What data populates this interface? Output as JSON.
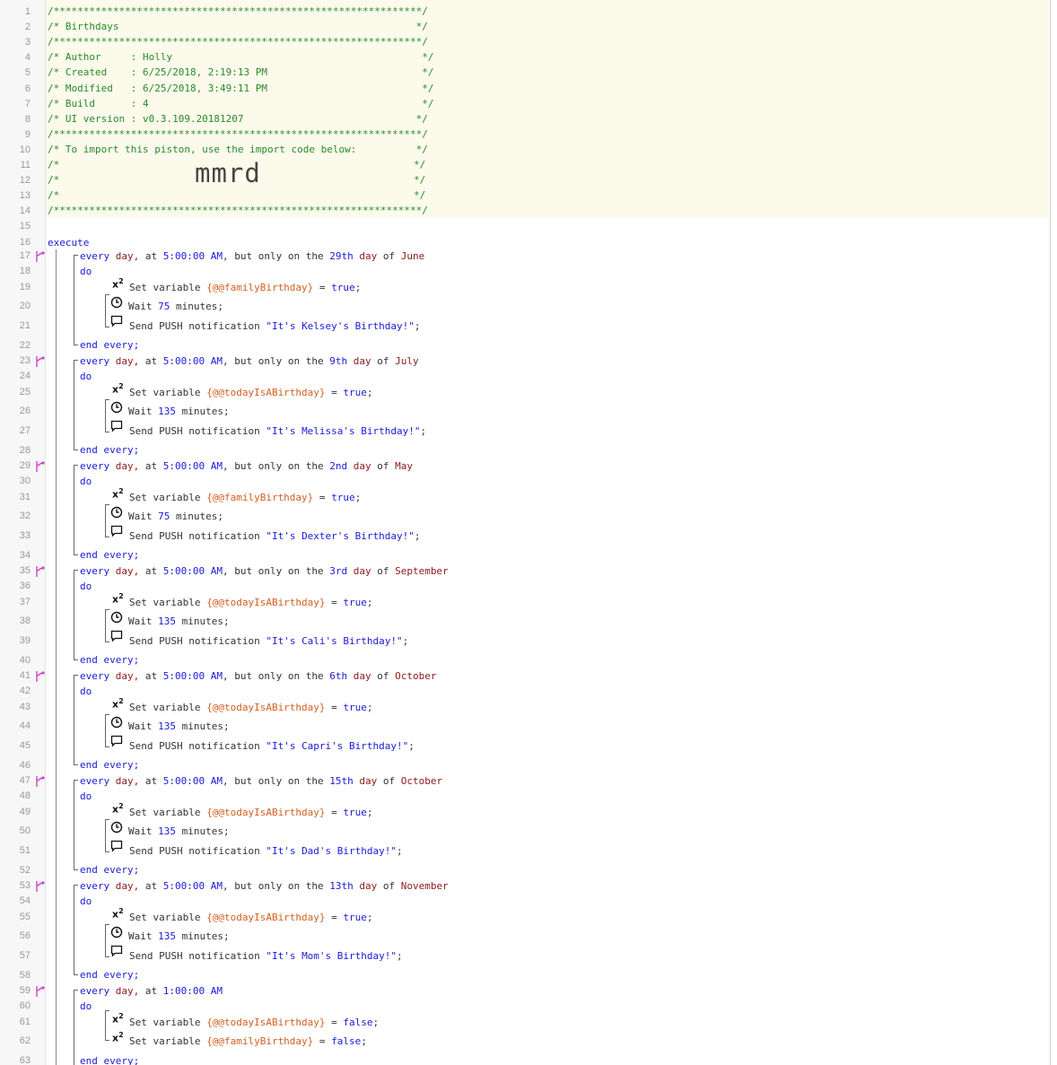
{
  "editor": {
    "header": {
      "line1": "/**************************************************************/",
      "title": "/* Birthdays                                                  */",
      "line3": "/**************************************************************/",
      "author": "/* Author     : Holly                                          */",
      "created": "/* Created    : 6/25/2018, 2:19:13 PM                          */",
      "modified": "/* Modified   : 6/25/2018, 3:49:11 PM                          */",
      "build": "/* Build      : 4                                              */",
      "ui_version": "/* UI version : v0.3.109.20181207                             */",
      "line9": "/**************************************************************/",
      "import_text": "/* To import this piston, use the import code below:          */",
      "blank_left": "/*",
      "blank_right": "*/",
      "import_code": "mmrd",
      "line14": "/**************************************************************/"
    },
    "execute": "execute",
    "blocks": [
      {
        "start": 17,
        "time": "5:00:00 AM",
        "daynum": "29th",
        "month": "June",
        "var": "{@@familyBirthday}",
        "wait": "75",
        "msg": "\"It's Kelsey's Birthday!\""
      },
      {
        "start": 23,
        "time": "5:00:00 AM",
        "daynum": "9th",
        "month": "July",
        "var": "{@@todayIsABirthday}",
        "wait": "135",
        "msg": "\"It's Melissa's Birthday!\""
      },
      {
        "start": 29,
        "time": "5:00:00 AM",
        "daynum": "2nd",
        "month": "May",
        "var": "{@@familyBirthday}",
        "wait": "75",
        "msg": "\"It's Dexter's Birthday!\""
      },
      {
        "start": 35,
        "time": "5:00:00 AM",
        "daynum": "3rd",
        "month": "September",
        "var": "{@@todayIsABirthday}",
        "wait": "135",
        "msg": "\"It's Cali's Birthday!\""
      },
      {
        "start": 41,
        "time": "5:00:00 AM",
        "daynum": "6th",
        "month": "October",
        "var": "{@@todayIsABirthday}",
        "wait": "135",
        "msg": "\"It's Capri's Birthday!\""
      },
      {
        "start": 47,
        "time": "5:00:00 AM",
        "daynum": "15th",
        "month": "October",
        "var": "{@@todayIsABirthday}",
        "wait": "135",
        "msg": "\"It's Dad's Birthday!\""
      },
      {
        "start": 53,
        "time": "5:00:00 AM",
        "daynum": "13th",
        "month": "November",
        "var": "{@@todayIsABirthday}",
        "wait": "135",
        "msg": "\"It's Mom's Birthday!\""
      }
    ],
    "final_block": {
      "start": 59,
      "time": "1:00:00 AM",
      "var1": "{@@todayIsABirthday}",
      "var2": "{@@familyBirthday}",
      "val": "false"
    },
    "tokens": {
      "every": "every",
      "day": "day,",
      "at": " at ",
      "but": ", but only on the ",
      "dayword": "day",
      "of": " of ",
      "do": "do",
      "set": "Set variable ",
      "eq": " = ",
      "true": "true",
      "semi": ";",
      "wait": "Wait ",
      "minutes": " minutes;",
      "send": "Send PUSH notification ",
      "end": "end every;",
      "x2": "x",
      "x2sup": "2"
    },
    "line_count": 63
  }
}
